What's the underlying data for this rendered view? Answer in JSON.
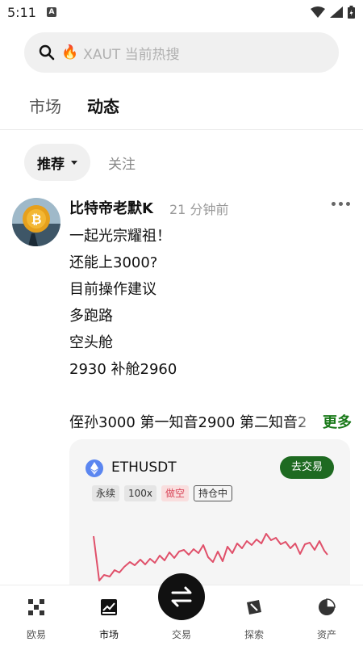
{
  "status": {
    "time": "5:11",
    "notif": "A"
  },
  "search": {
    "emoji": "🔥",
    "placeholder": "XAUT 当前热搜"
  },
  "main_tabs": [
    {
      "label": "市场",
      "active": false
    },
    {
      "label": "动态",
      "active": true
    }
  ],
  "sub_tabs": {
    "selected": "推荐",
    "other": "关注"
  },
  "post": {
    "author": "比特帝老默K",
    "time": "21 分钟前",
    "lines": [
      "一起光宗耀祖！",
      "还能上3000?",
      "目前操作建议",
      "多跑路",
      "空头舱",
      "2930  补舱2960"
    ],
    "last_line": "侄孙3000 第一知音2900 第二知音2",
    "more_label": "更多"
  },
  "trade_card": {
    "symbol": "ETHUSDT",
    "trade_button": "去交易",
    "tags": [
      "永续",
      "100x",
      "做空",
      "持仓中"
    ],
    "price_line_color": "#e0506a",
    "short_tag_color": "#d9475a"
  },
  "bottom_nav": [
    {
      "label": "欧易",
      "icon": "okx-logo-icon"
    },
    {
      "label": "市场",
      "icon": "market-chart-icon",
      "active": true
    },
    {
      "label": "交易",
      "icon": "swap-arrows-icon"
    },
    {
      "label": "探索",
      "icon": "compass-icon"
    },
    {
      "label": "资产",
      "icon": "pie-chart-icon"
    }
  ],
  "colors": {
    "accent_green": "#1e6a21",
    "more_green": "#1a7a1a"
  }
}
